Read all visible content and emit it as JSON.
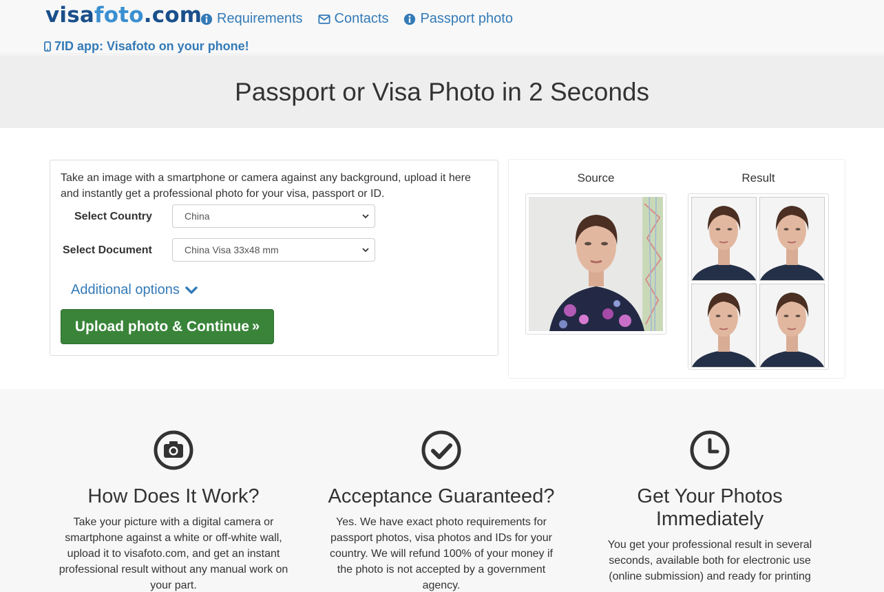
{
  "header": {
    "logo_main": "visa",
    "logo_accent": "foto",
    "logo_tld": ".com",
    "nav": [
      {
        "label": "Requirements",
        "icon": "info-circle-icon"
      },
      {
        "label": "Contacts",
        "icon": "envelope-icon"
      },
      {
        "label": "Passport photo",
        "icon": "info-circle-icon"
      }
    ],
    "app_link": "7ID app: Visafoto on your phone!"
  },
  "hero": {
    "title": "Passport or Visa Photo in 2 Seconds"
  },
  "form": {
    "intro": "Take an image with a smartphone or camera against any background, upload it here and instantly get a professional photo for your visa, passport or ID.",
    "country_label": "Select Country",
    "country_value": "China",
    "document_label": "Select Document",
    "document_value": "China Visa 33x48 mm",
    "additional_options": "Additional options",
    "upload_button": "Upload photo & Continue",
    "upload_arrows": "»"
  },
  "example": {
    "source_label": "Source",
    "result_label": "Result"
  },
  "features": [
    {
      "icon": "camera-icon",
      "title": "How Does It Work?",
      "text": "Take your picture with a digital camera or smartphone against a white or off-white wall, upload it to visafoto.com, and get an instant professional result without any manual work on your part."
    },
    {
      "icon": "check-circle-icon",
      "title": "Acceptance Guaranteed?",
      "text": "Yes. We have exact photo requirements for passport photos, visa photos and IDs for your country. We will refund 100% of your money if the photo is not accepted by a government agency."
    },
    {
      "icon": "clock-icon",
      "title": "Get Your Photos Immediately",
      "text": "You get your professional result in several seconds, available both for electronic use (online submission) and ready for printing"
    }
  ],
  "colors": {
    "link": "#337ab7",
    "logo_dark": "#1a4f8b",
    "upload_button": "#398439"
  }
}
